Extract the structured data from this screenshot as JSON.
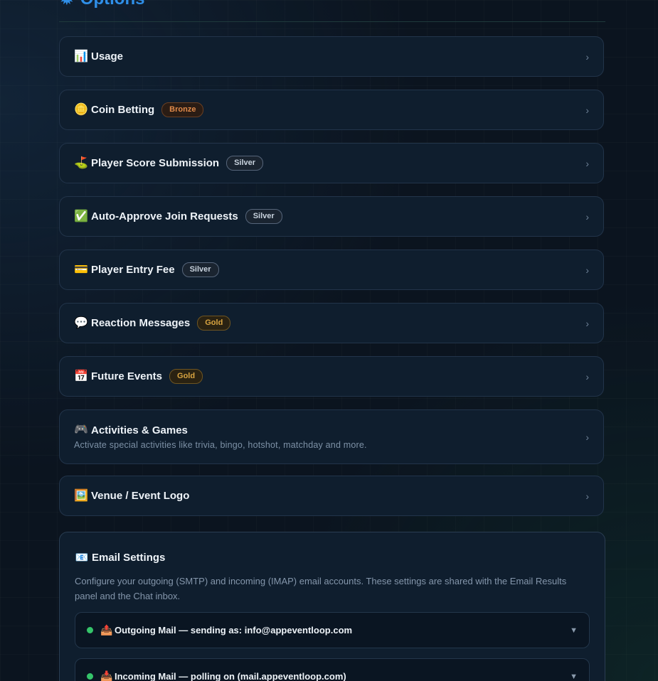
{
  "section": {
    "icon": "gear-icon",
    "title": "Options"
  },
  "options": [
    {
      "emoji": "📊",
      "label": "Usage",
      "badge": ""
    },
    {
      "emoji": "🪙",
      "label": "Coin Betting",
      "badge": "Bronze"
    },
    {
      "emoji": "⛳",
      "label": "Player Score Submission",
      "badge": "Silver"
    },
    {
      "emoji": "✅",
      "label": "Auto-Approve Join Requests",
      "badge": "Silver"
    },
    {
      "emoji": "💳",
      "label": "Player Entry Fee",
      "badge": "Silver"
    },
    {
      "emoji": "💬",
      "label": "Reaction Messages",
      "badge": "Gold"
    },
    {
      "emoji": "📅",
      "label": "Future Events",
      "badge": "Gold"
    },
    {
      "emoji": "🎮",
      "label": "Activities & Games",
      "description": "Activate special activities like trivia, bingo, hotshot, matchday and more."
    },
    {
      "emoji": "🖼️",
      "label": "Venue / Event Logo",
      "badge": ""
    }
  ],
  "chevron": "›",
  "email": {
    "emoji": "📧",
    "title": "Email Settings",
    "description": "Configure your outgoing (SMTP) and incoming (IMAP) email accounts. These settings are shared with the Email Results panel and the Chat inbox.",
    "outgoing": {
      "emoji": "📤",
      "label": "Outgoing Mail — sending as: info@appeventloop.com",
      "status_color": "#35c46a"
    },
    "incoming": {
      "emoji": "📥",
      "label": "Incoming Mail — polling on (mail.appeventloop.com)",
      "status_color": "#35c46a"
    },
    "caret": "▼"
  }
}
